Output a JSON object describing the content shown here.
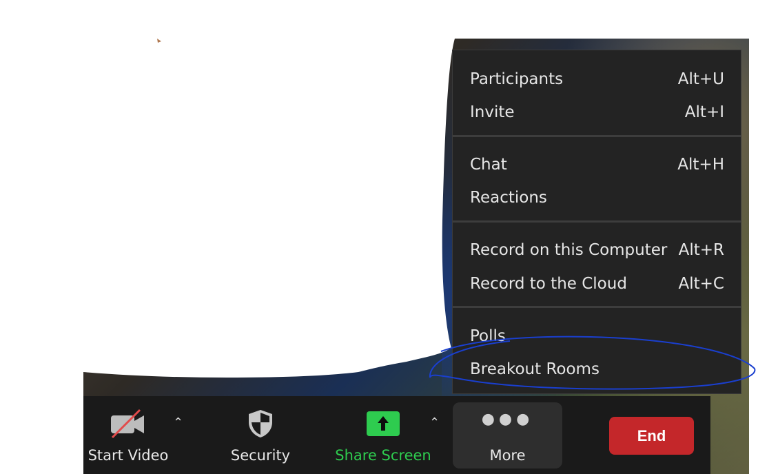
{
  "toolbar": {
    "start_video_label": "Start Video",
    "security_label": "Security",
    "share_screen_label": "Share Screen",
    "more_label": "More",
    "end_label": "End",
    "share_color": "#2ecc4f",
    "end_color": "#c4272a"
  },
  "menu": {
    "participants": {
      "label": "Participants",
      "shortcut": "Alt+U"
    },
    "invite": {
      "label": "Invite",
      "shortcut": "Alt+I"
    },
    "chat": {
      "label": "Chat",
      "shortcut": "Alt+H"
    },
    "reactions": {
      "label": "Reactions"
    },
    "record_computer": {
      "label": "Record on this Computer",
      "shortcut": "Alt+R"
    },
    "record_cloud": {
      "label": "Record to the Cloud",
      "shortcut": "Alt+C"
    },
    "polls": {
      "label": "Polls"
    },
    "breakout_rooms": {
      "label": "Breakout Rooms"
    }
  },
  "icons": {
    "video": "video-camera-off-icon",
    "security": "shield-icon",
    "share": "share-arrow-up-icon",
    "more": "ellipsis-icon",
    "caret": "caret-up-icon"
  }
}
